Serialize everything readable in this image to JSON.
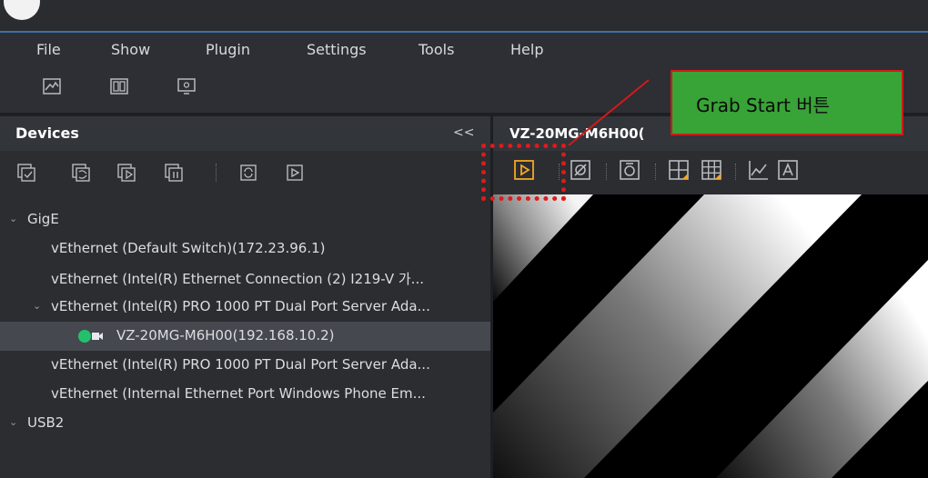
{
  "menu": [
    "File",
    "Show",
    "Plugin",
    "Settings",
    "Tools",
    "Help"
  ],
  "toolbar": {
    "icons": [
      "image-window-icon",
      "layout-icon",
      "monitor-settings-icon"
    ]
  },
  "devices_panel": {
    "title": "Devices",
    "collapse": "<<",
    "toolbar_icons": [
      "connect-device-icon",
      "disconnect-device-icon",
      "open-device-icon",
      "close-device-icon",
      "refresh-icon",
      "play-icon"
    ],
    "tree": [
      {
        "label": "GigE",
        "level": 0,
        "expanded": true
      },
      {
        "label": "vEthernet (Default Switch)(172.23.96.1)",
        "level": 1
      },
      {
        "label": "vEthernet (Intel(R) Ethernet Connection (2) I219-V 가...",
        "level": 1
      },
      {
        "label": "vEthernet (Intel(R) PRO 1000 PT Dual Port Server Ada...",
        "level": 1,
        "expanded": true
      },
      {
        "label": "VZ-20MG-M6H00(192.168.10.2)",
        "level": 2,
        "selected": true
      },
      {
        "label": "vEthernet (Intel(R) PRO 1000 PT Dual Port Server Ada...",
        "level": 1
      },
      {
        "label": "vEthernet (Internal Ethernet Port Windows Phone Em...",
        "level": 1
      },
      {
        "label": "USB2",
        "level": 0,
        "expanded": true
      }
    ]
  },
  "view": {
    "title": "VZ-20MG-M6H00(",
    "toolbar_icons": [
      "grab-start-icon",
      "stop-icon",
      "snapshot-icon",
      "crosshair-icon",
      "grid-icon",
      "histogram-icon",
      "text-overlay-icon"
    ]
  },
  "annotation": {
    "text": "Grab Start 버튼"
  },
  "colors": {
    "accent_orange": "#f5a623",
    "callout_green": "#38a337",
    "callout_border": "#d11a1a",
    "online_green": "#23c16b"
  }
}
